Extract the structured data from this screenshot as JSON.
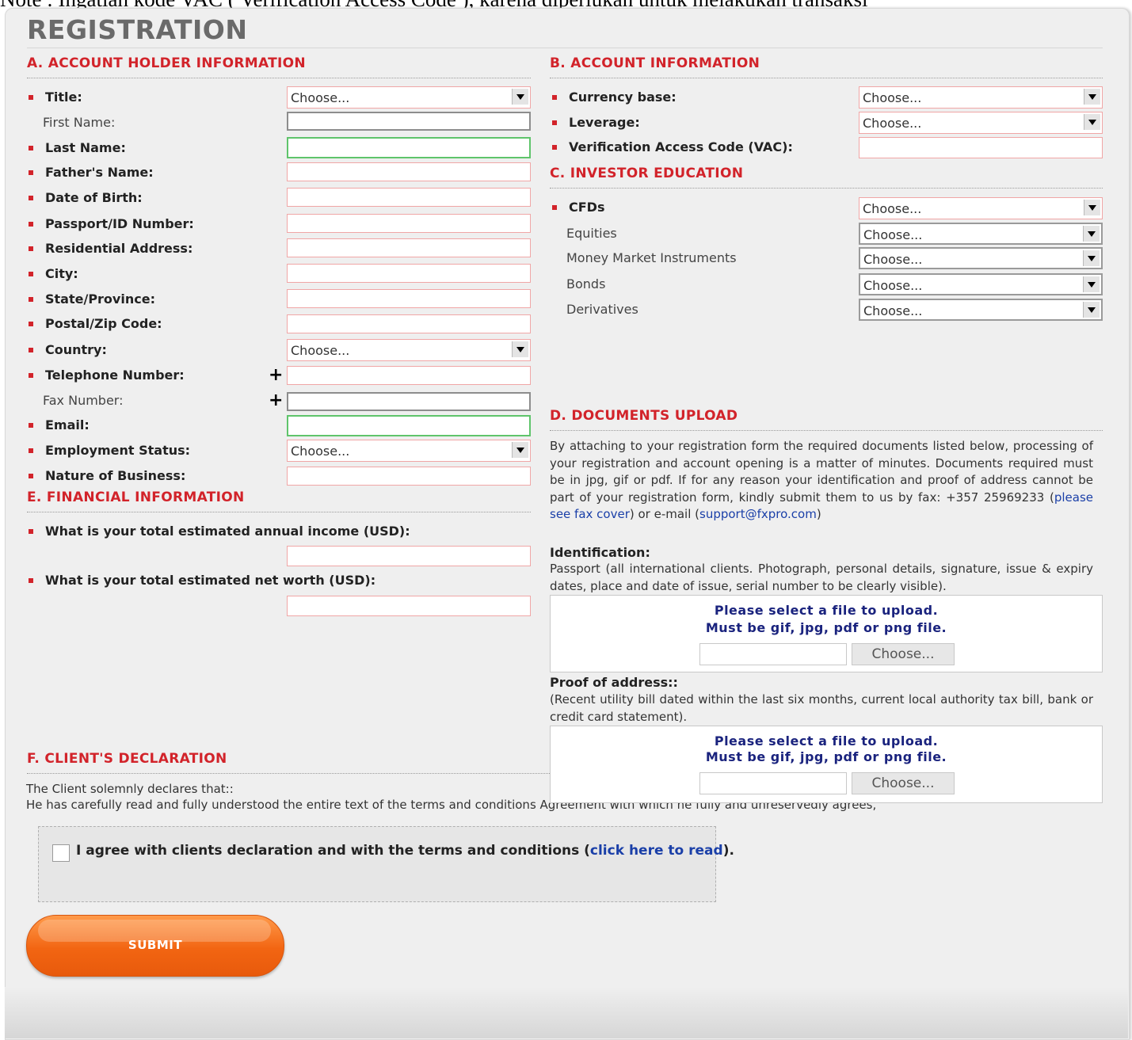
{
  "note": "Note : Ingatlah kode VAC ( Verification Access Code ), karena diperlukan untuk melakukan transaksi",
  "title": "REGISTRATION",
  "sections": {
    "a": "A. ACCOUNT HOLDER INFORMATION",
    "b": "B. ACCOUNT INFORMATION",
    "c": "C. INVESTOR EDUCATION",
    "d": "D. DOCUMENTS UPLOAD",
    "e": "E. FINANCIAL INFORMATION",
    "f": "F. CLIENT'S DECLARATION"
  },
  "account_holder": {
    "title_label": "Title:",
    "first_name_label": "First Name:",
    "last_name_label": "Last Name:",
    "fathers_name_label": "Father's Name:",
    "dob_label": "Date of Birth:",
    "passport_label": "Passport/ID Number:",
    "address_label": "Residential Address:",
    "city_label": "City:",
    "state_label": "State/Province:",
    "postal_label": "Postal/Zip Code:",
    "country_label": "Country:",
    "telephone_label": "Telephone Number:",
    "fax_label": "Fax Number:",
    "email_label": "Email:",
    "employment_label": "Employment Status:",
    "business_label": "Nature of Business:",
    "plus_sign": "+"
  },
  "choose": "Choose...",
  "account_info": {
    "currency_label": "Currency base:",
    "leverage_label": "Leverage:",
    "vac_label": "Verification Access Code (VAC):"
  },
  "investor_education": {
    "cfds_label": "CFDs",
    "equities_label": "Equities",
    "money_market_label": "Money Market Instruments",
    "bonds_label": "Bonds",
    "derivatives_label": "Derivatives"
  },
  "financial": {
    "income_label": "What is your total estimated annual income (USD):",
    "networth_label": "What is your total estimated net worth (USD):"
  },
  "documents": {
    "intro_before_link": "By attaching to your registration form the required documents listed below, processing of your registration and account opening is a matter of minutes. Documents required must be in jpg, gif or pdf. If for any reason your identification and proof of address cannot be part of your registration form, kindly submit them to us by fax: +357 25969233 (",
    "fax_link": "please see fax cover",
    "intro_middle": ") or e-mail (",
    "email_link": "support@fxpro.com",
    "intro_end": ")",
    "identification_title": "Identification:",
    "identification_text": "Passport (all international clients. Photograph, personal details, signature, issue & expiry dates, place and date of issue, serial number to be clearly visible).",
    "proof_title": "Proof of address::",
    "proof_text": "(Recent utility bill dated within the last six months, current local authority tax bill, bank or credit card statement).",
    "upload_msg_1": "Please select a file to upload.",
    "upload_msg_2": "Must be gif, jpg, pdf or png file.",
    "upload_button": "Choose..."
  },
  "declaration": {
    "line1": "The Client solemnly declares that::",
    "line2": "He has carefully read and fully understood the entire text of the terms and conditions Agreement with which he fully and unreservedly agrees,",
    "agree_text": "I agree with clients declaration and with the terms and conditions (",
    "agree_link": "click here to read",
    "agree_end": ")."
  },
  "submit_label": "SUBMIT",
  "colors": {
    "section_red": "#d2232a",
    "link_blue": "#1a3fa8",
    "upload_blue": "#1a237e",
    "submit_orange": "#f26512"
  }
}
